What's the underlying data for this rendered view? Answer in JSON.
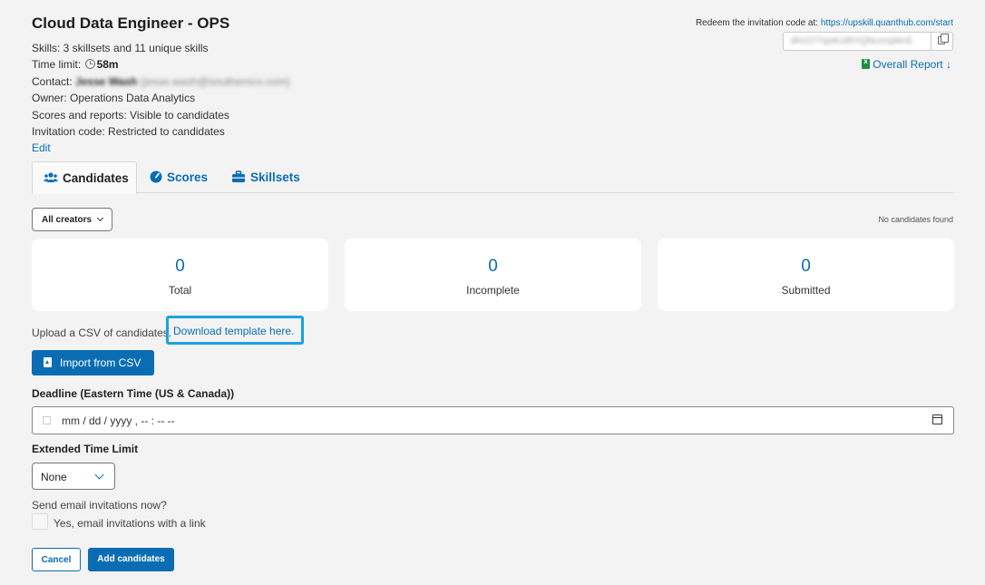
{
  "header": {
    "title": "Cloud Data Engineer - OPS",
    "skills": "Skills: 3 skillsets and 11 unique skills",
    "time_limit_label": "Time limit:",
    "time_limit_value": "58m",
    "contact_label": "Contact:",
    "contact_name": "Jesse Wash",
    "contact_email": "(jesse.wash@southernco.com)",
    "owner": "Owner: Operations Data Analytics",
    "scores_reports": "Scores and reports: Visible to candidates",
    "invitation_code": "Invitation code: Restricted to candidates",
    "edit_label": "Edit"
  },
  "redeem": {
    "text": "Redeem the invitation code at:",
    "url": "https://upskill.quanthub.com/start",
    "code": "dhcO77qoitUd5YQNconqWn5",
    "overall_report": "Overall Report"
  },
  "tabs": [
    {
      "label": "Candidates",
      "active": true
    },
    {
      "label": "Scores",
      "active": false
    },
    {
      "label": "Skillsets",
      "active": false
    }
  ],
  "filter": {
    "creator_label": "All creators",
    "no_candidates": "No candidates found"
  },
  "stats": [
    {
      "value": "0",
      "label": "Total"
    },
    {
      "value": "0",
      "label": "Incomplete"
    },
    {
      "value": "0",
      "label": "Submitted"
    }
  ],
  "upload": {
    "text": "Upload a CSV of candidates.",
    "link": "Download template here.",
    "import_label": "Import from CSV"
  },
  "form": {
    "deadline_label": "Deadline (Eastern Time (US & Canada))",
    "deadline_value": "mm / dd / yyyy ,  -- : --   --",
    "extended_label": "Extended Time Limit",
    "extended_value": "None",
    "send_label": "Send email invitations now?",
    "checkbox_label": "Yes, email invitations with a link",
    "cancel_label": "Cancel",
    "add_label": "Add candidates"
  },
  "colors": {
    "primary": "#0a6db3",
    "highlight": "#1aa3e0",
    "background": "#f3f3f3"
  }
}
